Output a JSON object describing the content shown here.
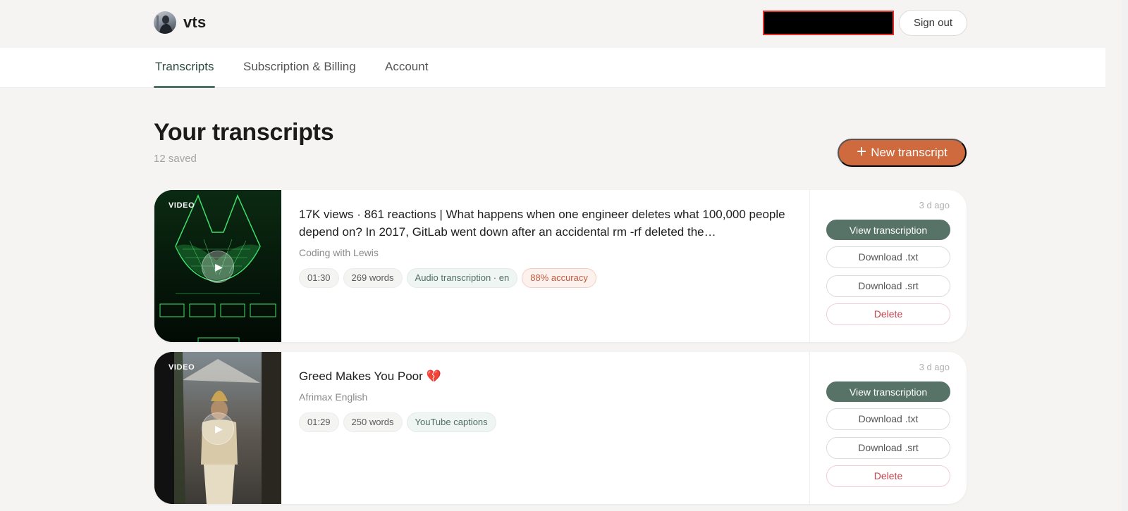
{
  "brand": {
    "name": "vts"
  },
  "header": {
    "sign_out_label": "Sign out"
  },
  "nav": {
    "tabs": [
      {
        "label": "Transcripts",
        "active": true
      },
      {
        "label": "Subscription & Billing",
        "active": false
      },
      {
        "label": "Account",
        "active": false
      }
    ]
  },
  "page": {
    "title": "Your transcripts",
    "subtitle": "12 saved",
    "new_button_label": "New transcript",
    "new_button_icon": "plus-icon"
  },
  "colors": {
    "accent": "#cf6a3e",
    "primary": "#577367",
    "danger": "#c2454f",
    "background": "#f5f4f2"
  },
  "transcripts": [
    {
      "badge": "VIDEO",
      "title": "17K views · 861 reactions | What happens when one engineer deletes what 100,000 people depend on? In 2017, GitLab went down after an accidental rm -rf deleted the…",
      "channel": "Coding with Lewis",
      "duration": "01:30",
      "words": "269 words",
      "source": "Audio transcription · en",
      "accuracy": "88% accuracy",
      "time_ago": "3 d ago",
      "view_label": "View transcription",
      "download_txt_label": "Download .txt",
      "download_srt_label": "Download .srt",
      "delete_label": "Delete"
    },
    {
      "badge": "VIDEO",
      "title": "Greed Makes You Poor 💔",
      "channel": "Afrimax English",
      "duration": "01:29",
      "words": "250 words",
      "source": "YouTube captions",
      "time_ago": "3 d ago",
      "view_label": "View transcription",
      "download_txt_label": "Download .txt",
      "download_srt_label": "Download .srt",
      "delete_label": "Delete"
    }
  ]
}
